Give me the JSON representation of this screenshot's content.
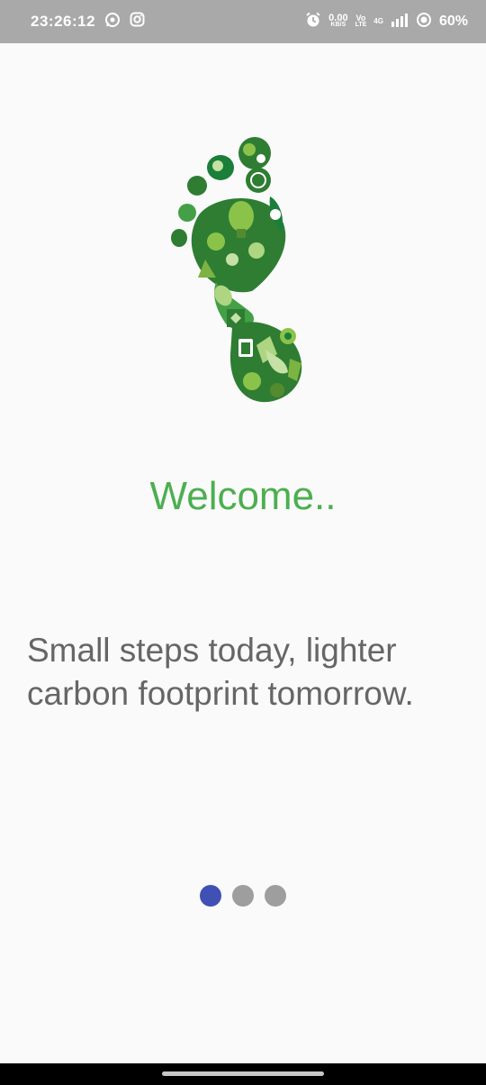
{
  "status_bar": {
    "time": "23:26:12",
    "net_speed_value": "0.00",
    "net_speed_unit": "KB/S",
    "volte_top": "Vo",
    "volte_bottom": "LTE",
    "network_type": "4G",
    "battery": "60%"
  },
  "onboarding": {
    "welcome": "Welcome..",
    "tagline": "Small steps today, lighter carbon footprint tomorrow.",
    "pages": [
      {
        "active": true
      },
      {
        "active": false
      },
      {
        "active": false
      }
    ]
  },
  "colors": {
    "accent_green": "#4caf50",
    "dark_green": "#1b7f3a",
    "light_green": "#8bc34a",
    "indicator_active": "#3f51b5",
    "indicator_inactive": "#9e9e9e",
    "status_bar_bg": "#a9a9a9"
  },
  "icons": {
    "footprint": "footprint-eco-icon",
    "whatsapp": "whatsapp-icon",
    "instagram": "instagram-icon",
    "alarm": "alarm-icon",
    "signal": "signal-icon",
    "battery": "battery-icon"
  }
}
